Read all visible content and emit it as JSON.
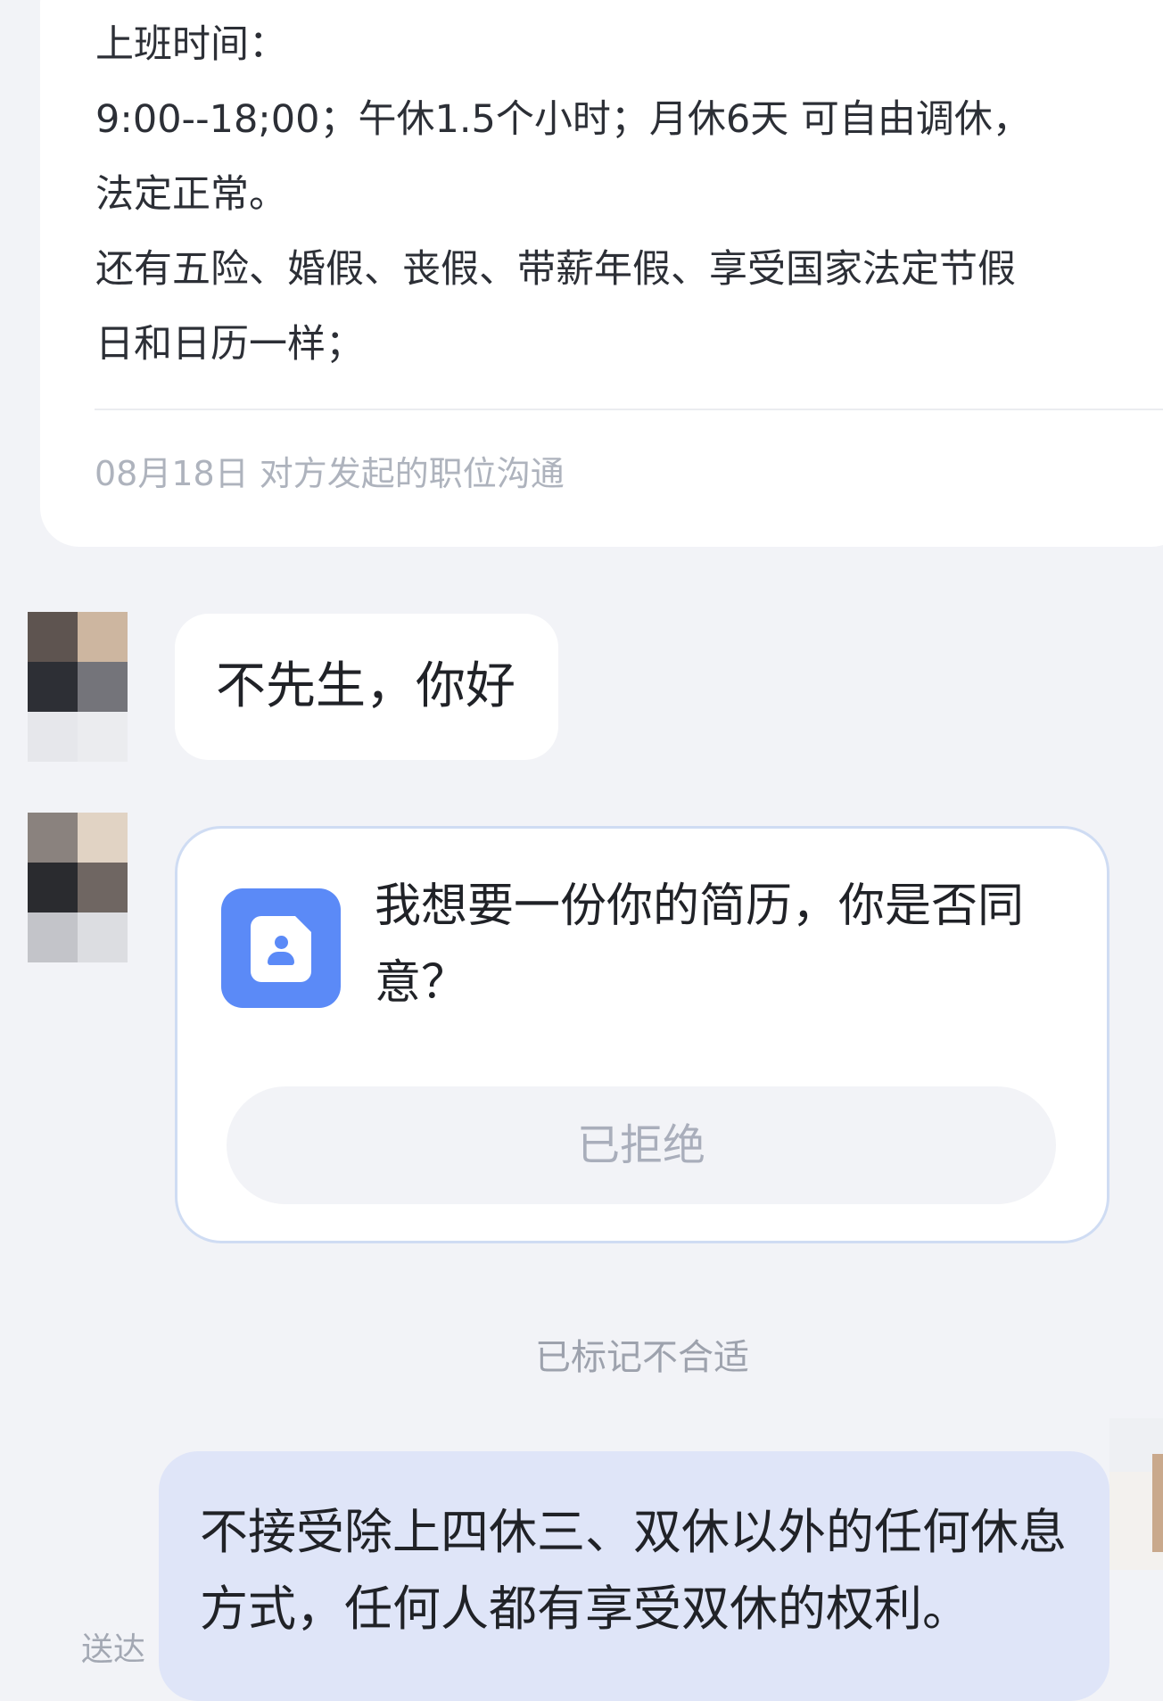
{
  "job_card": {
    "lines": [
      "上班时间：",
      "9:00--18;00；午休1.5个小时；月休6天 可自由调休，",
      "法定正常。",
      "还有五险、婚假、丧假、带薪年假、享受国家法定节假",
      "日和日历一样；"
    ],
    "meta": "08月18日 对方发起的职位沟通"
  },
  "messages": {
    "greeting": "不先生，你好",
    "resume_request": {
      "question": "我想要一份你的简历，你是否同意？",
      "icon": "resume-icon",
      "status_button": "已拒绝"
    },
    "system_note": "已标记不合适",
    "my_reply": "不接受除上四休三、双休以外的任何休息方式，任何人都有享受双休的权利。",
    "delivery_status": "送达"
  },
  "colors": {
    "background": "#f2f3f7",
    "card": "#ffffff",
    "my_bubble": "#dfe5f8",
    "accent_blue": "#5b8af7",
    "muted_text": "#aeb3bd"
  }
}
